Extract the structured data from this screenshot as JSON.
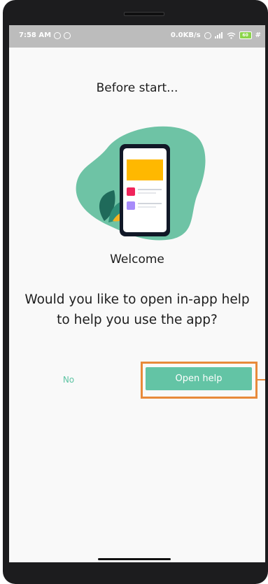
{
  "status_bar": {
    "time": "7:58 AM",
    "network_speed": "0.0KB/s",
    "battery_level": "60"
  },
  "dialog": {
    "title": "Before start...",
    "welcome": "Welcome",
    "question": "Would you like to open in-app help to help you use the app?",
    "no_label": "No",
    "open_label": "Open help"
  },
  "colors": {
    "accent": "#63c4a5",
    "highlight": "#e88a3a",
    "card_yellow": "#ffb800",
    "dot_pink": "#f0245b",
    "dot_purple": "#a78bfa"
  }
}
